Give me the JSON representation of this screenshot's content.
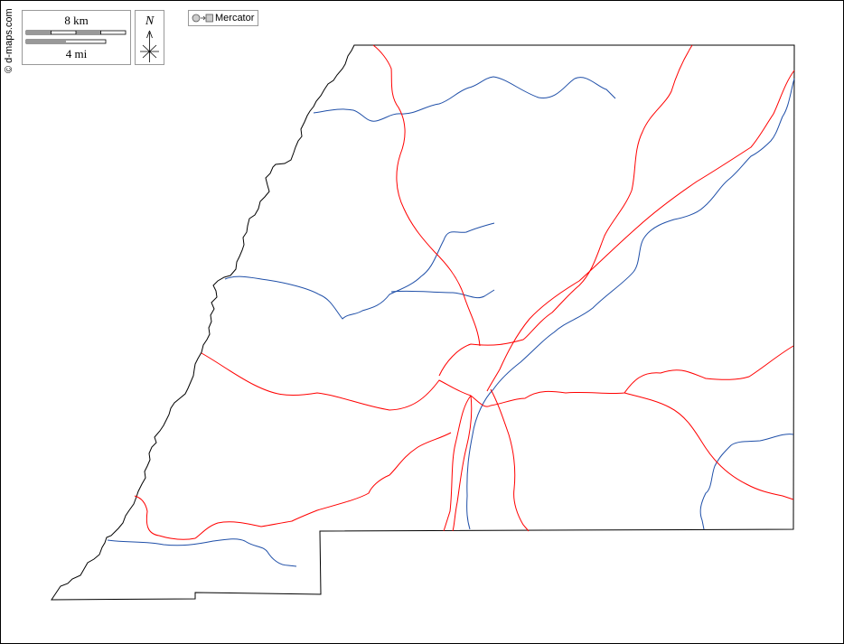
{
  "credit": "© d-maps.com",
  "scale": {
    "km_label": "8 km",
    "mi_label": "4 mi"
  },
  "north": {
    "letter": "N"
  },
  "projection": {
    "label": "Mercator",
    "icon": "circle-to-square-icon"
  },
  "colors": {
    "border": "#000000",
    "roads": "#ff0000",
    "rivers": "#1f4fa8",
    "boxes": "#999999"
  }
}
